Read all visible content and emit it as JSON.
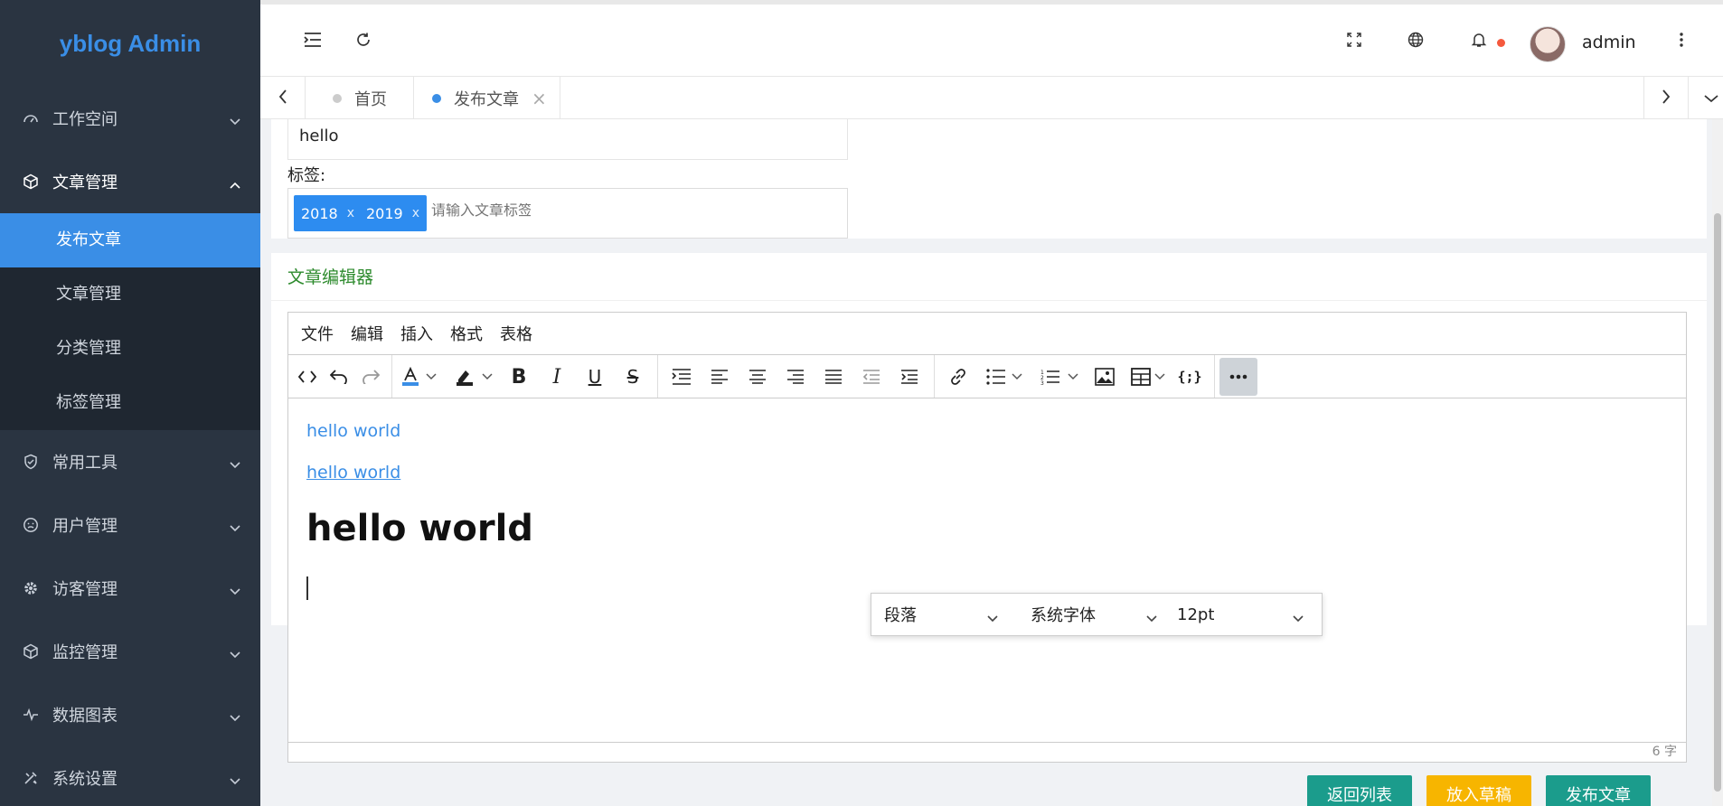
{
  "sidebar": {
    "logo": "yblog Admin",
    "items": [
      {
        "label": "工作空间",
        "icon": "dashboard-icon"
      },
      {
        "label": "文章管理",
        "icon": "cube-icon",
        "expanded": true
      },
      {
        "label": "常用工具",
        "icon": "shield-icon"
      },
      {
        "label": "用户管理",
        "icon": "smile-icon"
      },
      {
        "label": "访客管理",
        "icon": "gear-icon"
      },
      {
        "label": "监控管理",
        "icon": "cube-icon"
      },
      {
        "label": "数据图表",
        "icon": "pulse-icon"
      },
      {
        "label": "系统设置",
        "icon": "tools-icon"
      }
    ],
    "sub_items": [
      {
        "label": "发布文章",
        "active": true
      },
      {
        "label": "文章管理"
      },
      {
        "label": "分类管理"
      },
      {
        "label": "标签管理"
      }
    ]
  },
  "header": {
    "username": "admin"
  },
  "tabs": [
    {
      "label": "首页",
      "active": false
    },
    {
      "label": "发布文章",
      "active": true
    }
  ],
  "form": {
    "title_value": "hello",
    "tags_label": "标签:",
    "tags": [
      "2018",
      "2019"
    ],
    "tag_placeholder": "请输入文章标签"
  },
  "editor_card": {
    "title": "文章编辑器"
  },
  "editor": {
    "menu": [
      "文件",
      "编辑",
      "插入",
      "格式",
      "表格"
    ],
    "content": {
      "line1": "hello world",
      "line2": "hello world",
      "heading": "hello world"
    },
    "word_count": "6 字",
    "popover": {
      "block_format": "段落",
      "font_family": "系统字体",
      "font_size": "12pt"
    }
  },
  "actions": {
    "back": "返回列表",
    "draft": "放入草稿",
    "publish": "发布文章"
  },
  "colors": {
    "accent": "#3a8ee6",
    "sidebar_bg": "#2a3441",
    "teal": "#1b9c8c",
    "yellow": "#f7b500",
    "green_title": "#2e8b2e"
  }
}
